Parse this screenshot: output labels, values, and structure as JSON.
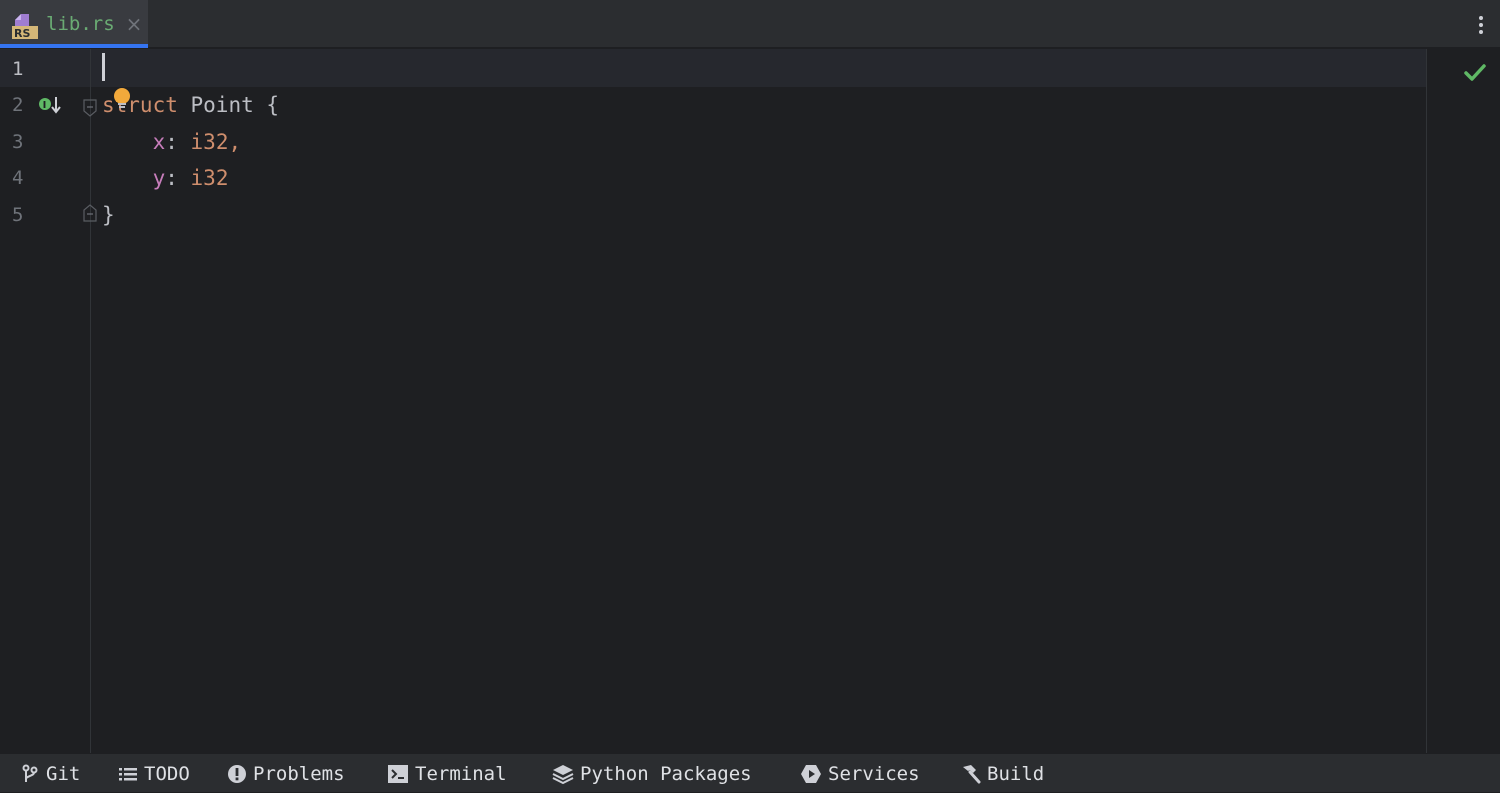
{
  "tab": {
    "icon": "rust-file-icon",
    "icon_badge": "RS",
    "label": "lib.rs",
    "close_glyph": "×"
  },
  "colors": {
    "background": "#1e1f22",
    "keyword": "#cf8e6d",
    "field": "#c77dbb",
    "tab_label": "#6aab73",
    "accent": "#3574f0",
    "check": "#5fb865",
    "bulb": "#f2a93b"
  },
  "editor": {
    "line_numbers": [
      "1",
      "2",
      "3",
      "4",
      "5"
    ],
    "lines": [
      {
        "tokens": []
      },
      {
        "tokens": [
          {
            "cls": "kw",
            "text": "struct"
          },
          {
            "cls": "punct",
            "text": " "
          },
          {
            "cls": "type",
            "text": "Point"
          },
          {
            "cls": "punct",
            "text": " {"
          }
        ]
      },
      {
        "tokens": [
          {
            "cls": "punct",
            "text": "    "
          },
          {
            "cls": "field",
            "text": "x"
          },
          {
            "cls": "punct",
            "text": ": "
          },
          {
            "cls": "prim",
            "text": "i32,"
          }
        ]
      },
      {
        "tokens": [
          {
            "cls": "punct",
            "text": "    "
          },
          {
            "cls": "field",
            "text": "y"
          },
          {
            "cls": "punct",
            "text": ": "
          },
          {
            "cls": "prim",
            "text": "i32"
          }
        ]
      },
      {
        "tokens": [
          {
            "cls": "punct",
            "text": "}"
          }
        ]
      }
    ],
    "current_line": 1,
    "status_icon": "check-icon"
  },
  "tool_windows": [
    {
      "label": "Git",
      "icon": "git-branch-icon"
    },
    {
      "label": "TODO",
      "icon": "list-icon"
    },
    {
      "label": "Problems",
      "icon": "exclamation-circle-icon"
    },
    {
      "label": "Terminal",
      "icon": "terminal-icon"
    },
    {
      "label": "Python Packages",
      "icon": "layers-icon"
    },
    {
      "label": "Services",
      "icon": "play-hexagon-icon"
    },
    {
      "label": "Build",
      "icon": "hammer-icon"
    }
  ]
}
